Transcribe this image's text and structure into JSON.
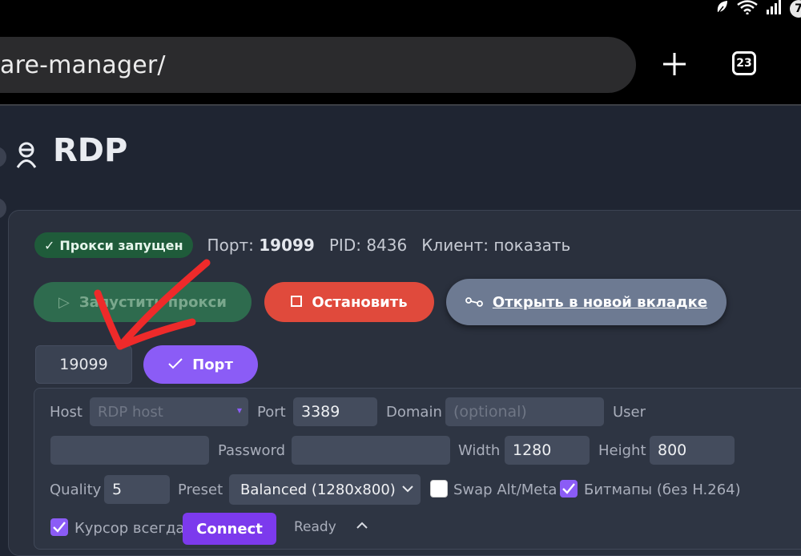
{
  "status_bar": {
    "badge": "7"
  },
  "browser": {
    "url": "are-manager/",
    "tab_count": "23"
  },
  "page": {
    "title": "RDP"
  },
  "status": {
    "badge": "Прокси запущен",
    "port_label": "Порт:",
    "port_value": "19099",
    "pid": "PID: 8436",
    "client_label": "Клиент:",
    "client_link": "показать"
  },
  "actions": {
    "start": "Запустить прокси",
    "stop": "Остановить",
    "open_tab": "Открыть в новой вкладке"
  },
  "port_field": {
    "value": "19099",
    "button": "Порт"
  },
  "form": {
    "host_label": "Host",
    "host_placeholder": "RDP host",
    "port_label": "Port",
    "port_value": "3389",
    "domain_label": "Domain",
    "domain_placeholder": "(optional)",
    "user_label": "User",
    "user_value": "",
    "password_label": "Password",
    "password_value": "",
    "width_label": "Width",
    "width_value": "1280",
    "height_label": "Height",
    "height_value": "800",
    "quality_label": "Quality",
    "quality_value": "5",
    "preset_label": "Preset",
    "preset_value": "Balanced (1280x800)",
    "swap_label": "Swap Alt/Meta",
    "swap_checked": false,
    "bitmap_label": "Битмапы (без H.264)",
    "bitmap_checked": true,
    "cursor_label": "Курсор всегда",
    "cursor_checked": true,
    "connect": "Connect",
    "state": "Ready"
  },
  "colors": {
    "accent": "#8b5cf6",
    "stop": "#e04a3c",
    "success": "#1f5b3a",
    "annotation": "#ee2a2a"
  }
}
